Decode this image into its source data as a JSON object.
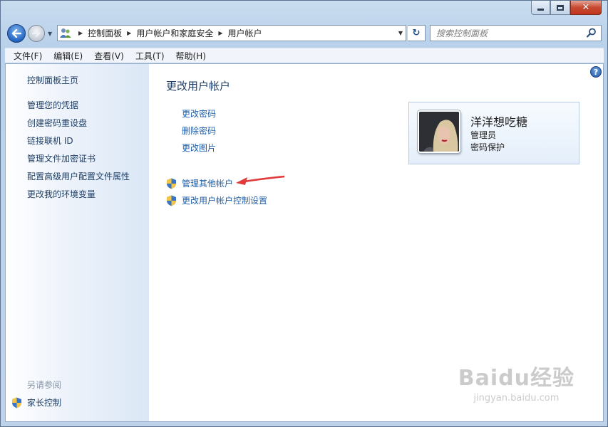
{
  "colors": {
    "link": "#1f5faa",
    "heading": "#1e3f66",
    "arrow": "#e03a3a"
  },
  "caption": {
    "minimize_icon": "minimize-icon",
    "maximize_icon": "maximize-icon",
    "close_label": "✕"
  },
  "address": {
    "crumbs": [
      "控制面板",
      "用户帐户和家庭安全",
      "用户帐户"
    ]
  },
  "search": {
    "placeholder": "搜索控制面板"
  },
  "menu": [
    "文件(F)",
    "编辑(E)",
    "查看(V)",
    "工具(T)",
    "帮助(H)"
  ],
  "sidebar": {
    "home": "控制面板主页",
    "items": [
      "管理您的凭据",
      "创建密码重设盘",
      "链接联机 ID",
      "管理文件加密证书",
      "配置高级用户配置文件属性",
      "更改我的环境变量"
    ],
    "see_also": "另请参阅",
    "parental": "家长控制"
  },
  "main": {
    "title": "更改用户帐户",
    "links": [
      "更改密码",
      "删除密码",
      "更改图片"
    ],
    "shield_links": [
      "管理其他帐户",
      "更改用户帐户控制设置"
    ],
    "help": "?"
  },
  "user": {
    "name": "洋洋想吃糖",
    "role": "管理员",
    "password_status": "密码保护"
  },
  "watermark": {
    "brand": "Baidu经验",
    "url": "jingyan.baidu.com"
  }
}
